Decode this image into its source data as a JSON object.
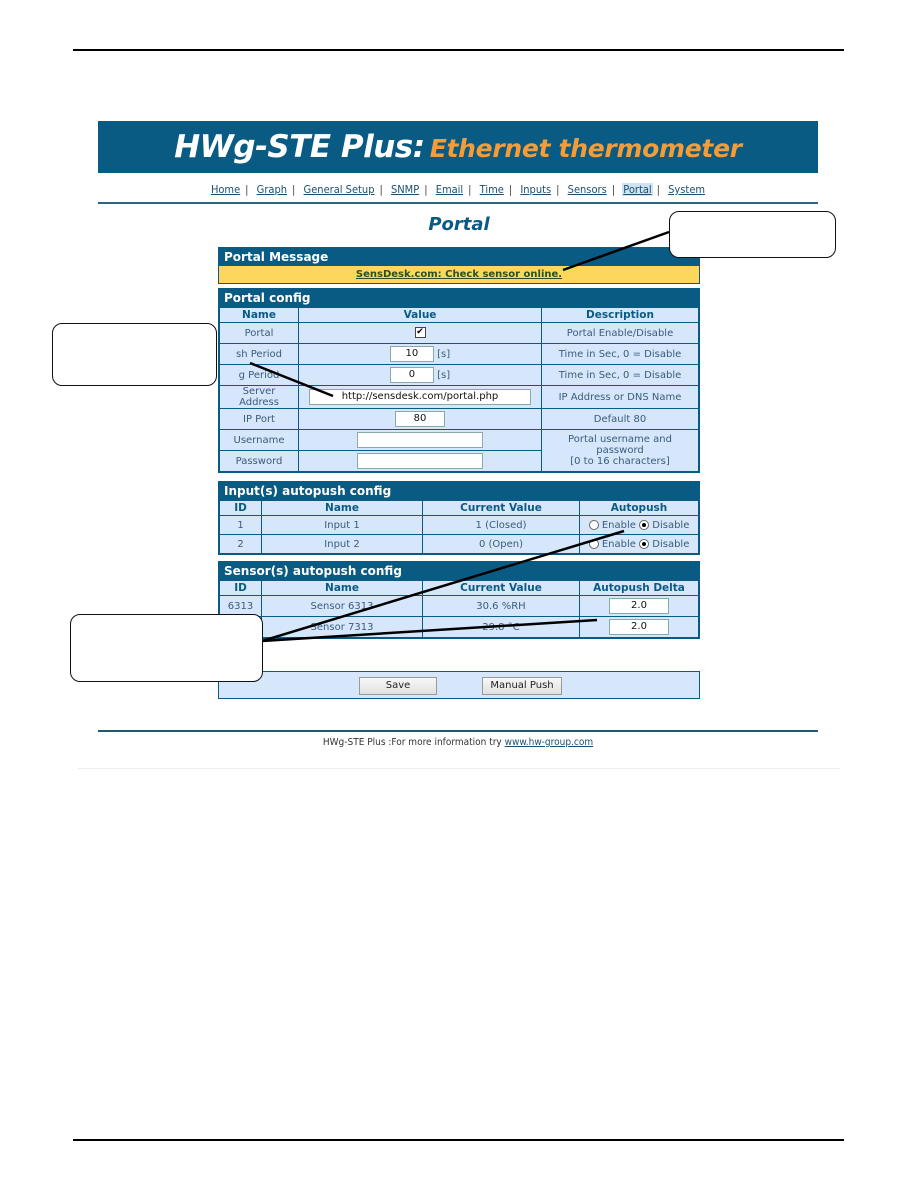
{
  "banner": {
    "product": "HWg-STE Plus:",
    "subtitle": "Ethernet thermometer"
  },
  "nav": {
    "items": [
      {
        "label": "Home"
      },
      {
        "label": "Graph"
      },
      {
        "label": "General Setup"
      },
      {
        "label": "SNMP"
      },
      {
        "label": "Email"
      },
      {
        "label": "Time"
      },
      {
        "label": "Inputs"
      },
      {
        "label": "Sensors"
      },
      {
        "label": "Portal",
        "active": true
      },
      {
        "label": "System"
      }
    ],
    "separator": "|"
  },
  "page_title": "Portal",
  "portal_message": {
    "header": "Portal Message",
    "message": "SensDesk.com: Check sensor online."
  },
  "portal_config": {
    "header": "Portal config",
    "columns": [
      "Name",
      "Value",
      "Description"
    ],
    "rows": {
      "portal": {
        "name": "Portal",
        "checked": true,
        "check_glyph": "✔",
        "desc": "Portal Enable/Disable"
      },
      "push_period": {
        "name": "sh Period",
        "value": "10",
        "unit": "[s]",
        "desc": "Time in Sec, 0 = Disable"
      },
      "log_period": {
        "name": "g Period",
        "value": "0",
        "unit": "[s]",
        "desc": "Time in Sec, 0 = Disable"
      },
      "server_address": {
        "name": "Server Address",
        "value": "http://sensdesk.com/portal.php",
        "desc": "IP Address or DNS Name"
      },
      "ip_port": {
        "name": "IP Port",
        "value": "80",
        "desc": "Default 80"
      },
      "username": {
        "name": "Username",
        "value": ""
      },
      "password": {
        "name": "Password",
        "value": ""
      },
      "credentials_desc_1": "Portal username and password",
      "credentials_desc_2": "[0 to 16 characters]"
    }
  },
  "inputs_autopush": {
    "header": "Input(s) autopush config",
    "columns": [
      "ID",
      "Name",
      "Current Value",
      "Autopush"
    ],
    "rows": [
      {
        "id": "1",
        "name": "Input 1",
        "value": "1 (Closed)",
        "enable_label": "Enable",
        "disable_label": "Disable",
        "selected": "Disable"
      },
      {
        "id": "2",
        "name": "Input 2",
        "value": "0 (Open)",
        "enable_label": "Enable",
        "disable_label": "Disable",
        "selected": "Disable"
      }
    ]
  },
  "sensors_autopush": {
    "header": "Sensor(s) autopush config",
    "columns": [
      "ID",
      "Name",
      "Current Value",
      "Autopush Delta"
    ],
    "rows": [
      {
        "id": "6313",
        "name": "Sensor 6313",
        "value": "30.6 %RH",
        "delta": "2.0"
      },
      {
        "id": "",
        "name": "Sensor 7313",
        "value": "29.8 °C",
        "delta": "2.0"
      }
    ]
  },
  "actions": {
    "save": "Save",
    "manual_push": "Manual Push"
  },
  "footer": {
    "text": "HWg-STE Plus :For more information try ",
    "link": "www.hw-group.com"
  }
}
